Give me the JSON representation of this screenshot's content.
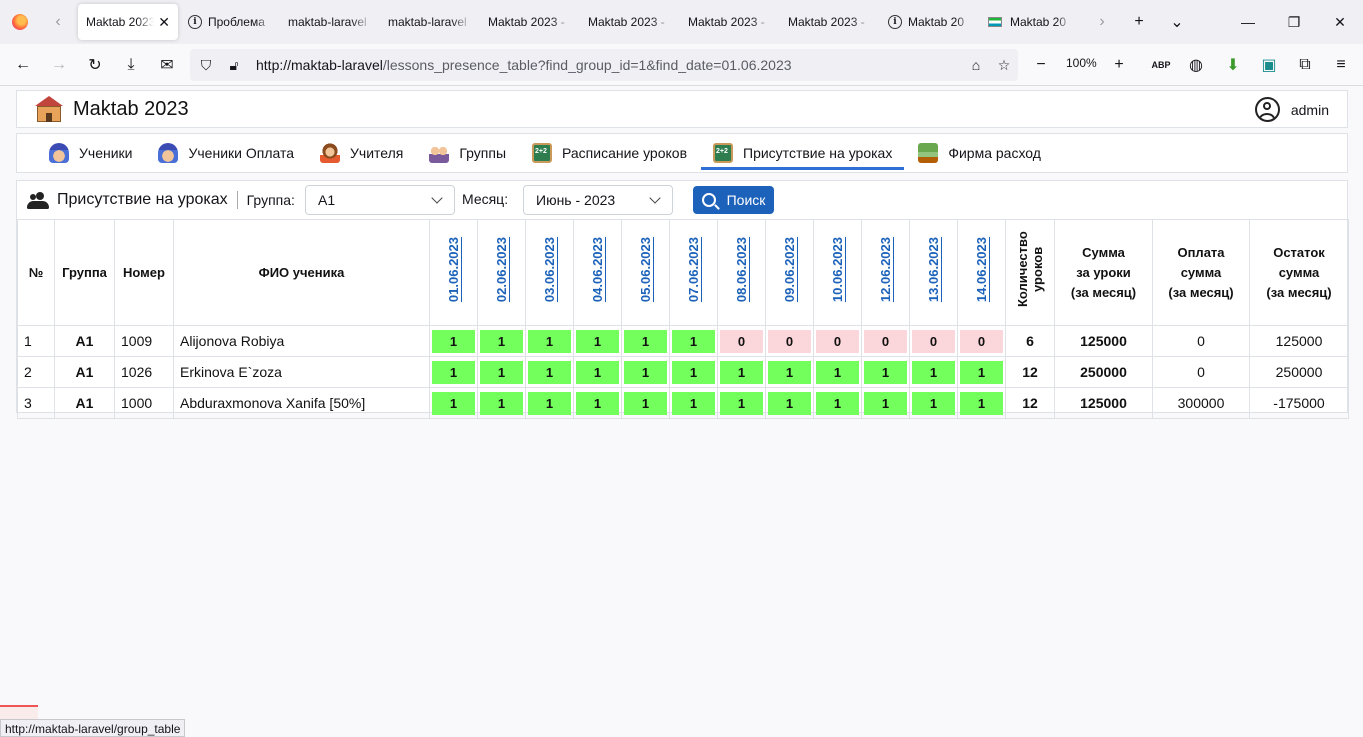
{
  "browser": {
    "tabs": [
      {
        "title": "Maktab 2023",
        "active": true
      },
      {
        "title": "Проблема",
        "icon": "info-icon"
      },
      {
        "title": "maktab-laravel"
      },
      {
        "title": "maktab-laravel"
      },
      {
        "title": "Maktab 2023 -"
      },
      {
        "title": "Maktab 2023 -"
      },
      {
        "title": "Maktab 2023 -"
      },
      {
        "title": "Maktab 2023 -"
      },
      {
        "title": "Maktab 20",
        "icon": "info-icon"
      },
      {
        "title": "Maktab 20",
        "icon": "flag-icon"
      }
    ],
    "url_host": "http://maktab-laravel",
    "url_path": "/lessons_presence_table?find_group_id=1&find_date=01.06.2023",
    "zoom": "100%",
    "status_url": "http://maktab-laravel/group_table"
  },
  "app": {
    "title": "Maktab 2023",
    "user": "admin"
  },
  "menu": [
    {
      "label": "Ученики",
      "icon": "student-icon",
      "active": false
    },
    {
      "label": "Ученики Оплата",
      "icon": "student-icon",
      "active": false
    },
    {
      "label": "Учителя",
      "icon": "teacher-icon",
      "active": false
    },
    {
      "label": "Группы",
      "icon": "group-icon",
      "active": false
    },
    {
      "label": "Расписание уроков",
      "icon": "chalkboard-icon",
      "active": false
    },
    {
      "label": "Присутствие на уроках",
      "icon": "chalkboard-icon",
      "active": true
    },
    {
      "label": "Фирма расход",
      "icon": "money-icon",
      "active": false
    }
  ],
  "toolbar": {
    "title": "Присутствие на уроках",
    "group_label": "Группа:",
    "group_value": "A1",
    "month_label": "Месяц:",
    "month_value": "Июнь - 2023",
    "search_label": "Поиск"
  },
  "table": {
    "headers": {
      "num": "№",
      "group": "Группа",
      "number": "Номер",
      "name": "ФИО ученика",
      "lessons_count": "Количество уроков",
      "sum_lessons": [
        "Сумма",
        "за уроки",
        "(за месяц)"
      ],
      "paid_sum": [
        "Оплата",
        "сумма",
        "(за месяц)"
      ],
      "balance": [
        "Остаток",
        "сумма",
        "(за месяц)"
      ]
    },
    "dates": [
      "01.06.2023",
      "02.06.2023",
      "03.06.2023",
      "04.06.2023",
      "05.06.2023",
      "07.06.2023",
      "08.06.2023",
      "09.06.2023",
      "10.06.2023",
      "12.06.2023",
      "13.06.2023",
      "14.06.2023"
    ],
    "rows": [
      {
        "num": "1",
        "group": "A1",
        "number": "1009",
        "name": "Alijonova Robiya",
        "marks": [
          "1",
          "1",
          "1",
          "1",
          "1",
          "1",
          "0",
          "0",
          "0",
          "0",
          "0",
          "0"
        ],
        "count": "6",
        "sum": "125000",
        "paid": "0",
        "balance": "125000"
      },
      {
        "num": "2",
        "group": "A1",
        "number": "1026",
        "name": "Erkinova E`zoza",
        "marks": [
          "1",
          "1",
          "1",
          "1",
          "1",
          "1",
          "1",
          "1",
          "1",
          "1",
          "1",
          "1"
        ],
        "count": "12",
        "sum": "250000",
        "paid": "0",
        "balance": "250000"
      },
      {
        "num": "3",
        "group": "A1",
        "number": "1000",
        "name": "Abduraxmonova Xanifa [50%]",
        "marks": [
          "1",
          "1",
          "1",
          "1",
          "1",
          "1",
          "1",
          "1",
          "1",
          "1",
          "1",
          "1"
        ],
        "count": "12",
        "sum": "125000",
        "paid": "300000",
        "balance": "-175000"
      }
    ]
  },
  "colors": {
    "present": "#73ff5c",
    "absent": "#fbd7db",
    "accent": "#1d62ba"
  }
}
